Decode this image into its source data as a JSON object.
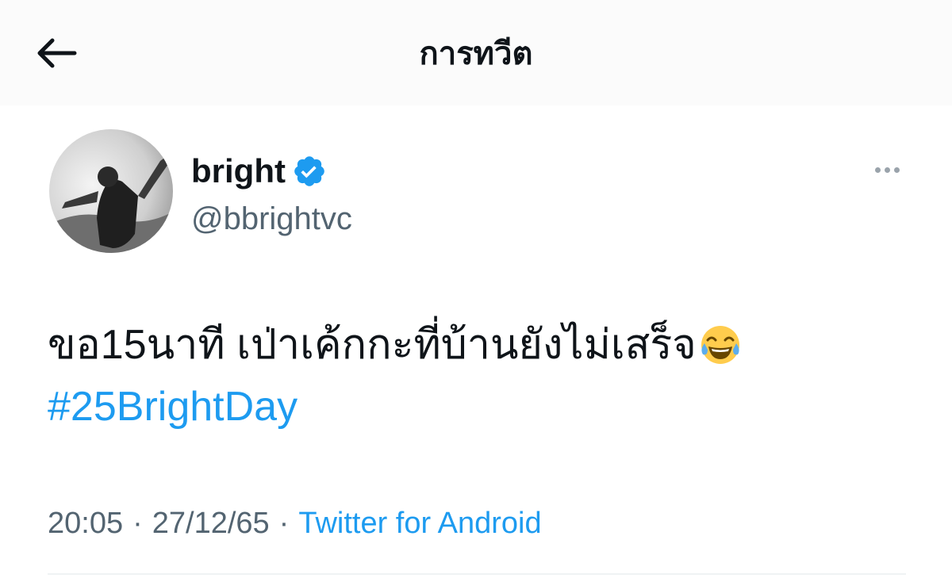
{
  "header": {
    "title": "การทวีต",
    "back_icon": "arrow-left-icon"
  },
  "author": {
    "name": "bright",
    "handle": "@bbrightvc",
    "verified_icon": "verified-badge-icon",
    "verified_color": "#1d9bf0"
  },
  "more_icon": "more-horizontal-icon",
  "tweet": {
    "text": "ขอ15นาที เป่าเค้กกะที่บ้านยังไม่เสร็จ",
    "emoji": "face-with-tears-of-joy",
    "hashtag": "#25BrightDay"
  },
  "meta": {
    "time": "20:05",
    "separator": "·",
    "date": "27/12/65",
    "source": "Twitter for Android"
  },
  "colors": {
    "link": "#1d9bf0",
    "secondary_text": "#536471",
    "primary_text": "#0f1419"
  }
}
